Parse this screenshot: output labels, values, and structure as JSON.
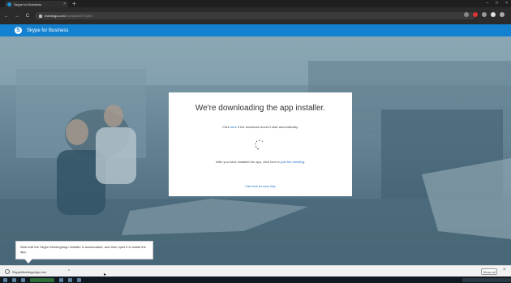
{
  "browser": {
    "tab_title": "Skype for Business",
    "tab_close": "×",
    "new_tab": "+",
    "window_controls": [
      "–",
      "□",
      "×"
    ],
    "url_host": "meetings.com",
    "url_path": "/meet/join/B7XQ09",
    "nav": {
      "back": "←",
      "forward": "→",
      "reload": "C"
    }
  },
  "app": {
    "logo_letter": "S",
    "name": "Skype for Business",
    "brand_color": "#1381d0"
  },
  "dialog": {
    "title": "We're downloading the app installer.",
    "line1_prefix": "Click ",
    "line1_link": "here",
    "line1_suffix": " if the download doesn't start automatically.",
    "line2_prefix": "After you have installed the app, click here to ",
    "line2_link": "join the meeting",
    "line2_suffix": ".",
    "help_link": "Click here for more help"
  },
  "tooltip": {
    "text": "Wait until the Skype MeetingsApp Installer is downloaded, and then open it to install the app."
  },
  "downloads": {
    "filename": "SkypeMeetingsApp.exe",
    "caret": "^",
    "show_all": "Show all",
    "close": "×"
  }
}
